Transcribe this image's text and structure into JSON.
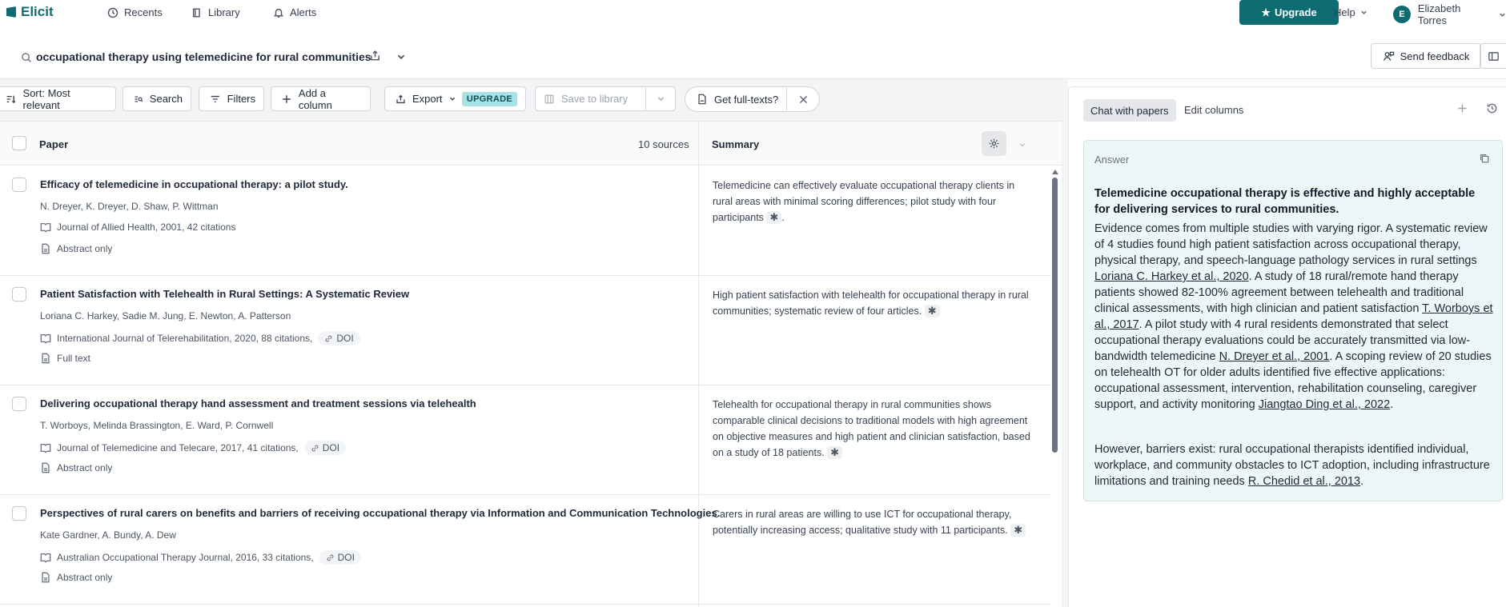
{
  "app": {
    "name": "Elicit"
  },
  "nav": {
    "recents": "Recents",
    "library": "Library",
    "alerts": "Alerts",
    "upgrade": "Upgrade",
    "help": "Help",
    "user_initial": "E",
    "user_name": "Elizabeth Torres"
  },
  "search": {
    "query": "occupational therapy using telemedicine for rural communities",
    "send_feedback": "Send feedback"
  },
  "toolbar": {
    "sort": "Sort: Most relevant",
    "search": "Search",
    "filters": "Filters",
    "add_column": "Add a column",
    "export": "Export",
    "upgrade_badge": "UPGRADE",
    "save_to_library": "Save to library",
    "get_full_texts": "Get full-texts?"
  },
  "table": {
    "col_paper": "Paper",
    "sources_count": "10 sources",
    "col_summary": "Summary",
    "rows": [
      {
        "title": "Efficacy of telemedicine in occupational therapy: a pilot study.",
        "authors": "N. Dreyer, K. Dreyer, D. Shaw, P. Wittman",
        "journal": "Journal of Allied Health, 2001, 42 citations",
        "doi": "",
        "access": "Abstract only",
        "summary": "Telemedicine can effectively evaluate occupational therapy clients in rural areas with minimal scoring differences; pilot study with four participants",
        "summary_end": "."
      },
      {
        "title": "Patient Satisfaction with Telehealth in Rural Settings: A Systematic Review",
        "authors": "Loriana C. Harkey, Sadie M. Jung, E. Newton, A. Patterson",
        "journal": "International Journal of Telerehabilitation, 2020, 88 citations,",
        "doi": "DOI",
        "access": "Full text",
        "summary": "High patient satisfaction with telehealth for occupational therapy in rural communities; systematic review of four articles.",
        "summary_end": ""
      },
      {
        "title": "Delivering occupational therapy hand assessment and treatment sessions via telehealth",
        "authors": "T. Worboys, Melinda Brassington, E. Ward, P. Cornwell",
        "journal": "Journal of Telemedicine and Telecare, 2017, 41 citations,",
        "doi": "DOI",
        "access": "Abstract only",
        "summary": "Telehealth for occupational therapy in rural communities shows comparable clinical decisions to traditional models with high agreement on objective measures and high patient and clinician satisfaction, based on a study of 18 patients.",
        "summary_end": ""
      },
      {
        "title": "Perspectives of rural carers on benefits and barriers of receiving occupational therapy via Information and Communication Technologies.",
        "authors": "Kate Gardner, A. Bundy, A. Dew",
        "journal": "Australian Occupational Therapy Journal, 2016, 33 citations,",
        "doi": "DOI",
        "access": "Abstract only",
        "summary": "Carers in rural areas are willing to use ICT for occupational therapy, potentially increasing access; qualitative study with 11 participants.",
        "summary_end": ""
      }
    ]
  },
  "panel": {
    "tab_chat": "Chat with papers",
    "tab_edit": "Edit columns",
    "answer_label": "Answer",
    "headline": "Telemedicine occupational therapy is effective and highly acceptable for delivering services to rural communities.",
    "p1": {
      "t1": "Evidence comes from multiple studies with varying rigor. A systematic review of 4 studies found high patient satisfaction across occupational therapy, physical therapy, and speech-language pathology services in rural settings ",
      "c1": "Loriana C. Harkey et al., 2020",
      "t2": ". A study of 18 rural/remote hand therapy patients showed 82-100% agreement between telehealth and traditional clinical assessments, with high clinician and patient satisfaction ",
      "c2": "T. Worboys et al., 2017",
      "t3": ". A pilot study with 4 rural residents demonstrated that select occupational therapy evaluations could be accurately transmitted via low-bandwidth telemedicine ",
      "c3": "N. Dreyer et al., 2001",
      "t4": ". A scoping review of 20 studies on telehealth OT for older adults identified five effective applications: occupational assessment, intervention, rehabilitation counseling, caregiver support, and activity monitoring ",
      "c4": "Jiangtao Ding et al., 2022",
      "t5": "."
    },
    "p2": {
      "t1": "However, barriers exist: rural occupational therapists identified individual, workplace, and community obstacles to ICT adoption, including infrastructure limitations and training needs ",
      "c1": "R. Chedid et al., 2013",
      "t2": "."
    }
  },
  "icons": {
    "recents": "clock-icon",
    "library": "book-icon",
    "alerts": "bell-icon",
    "upgrade": "star-icon",
    "search": "search-icon",
    "share": "share-icon",
    "feedback": "feedback-icon",
    "settings": "gear-icon",
    "citation": "asterisk-icon"
  },
  "colors": {
    "brand": "#0f6b72",
    "upgrade_badge": "#a7e3e6",
    "answer_bg": "#eef7f7"
  }
}
